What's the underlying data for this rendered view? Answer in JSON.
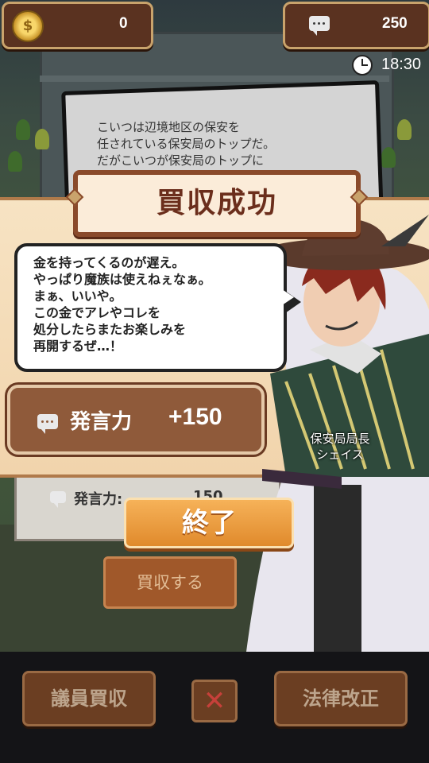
{
  "hud": {
    "coins": "0",
    "influence": "250",
    "time": "18:30"
  },
  "background_dialog": {
    "text": "こいつは辺境地区の保安を\n任されている保安局のトップだ。\nだがこいつが保安局のトップに"
  },
  "background_panel": {
    "label": "発言力:",
    "value": "150"
  },
  "popup": {
    "title": "買収成功",
    "speech": "金を持ってくるのが遅え。\nやっぱり魔族は使えねぇなぁ。\nまぁ、いいや。\nこの金でアレやコレを\n処分したらまたお楽しみを\n再開するぜ…！",
    "reward_label": "発言力",
    "reward_value": "+150",
    "character_name": "保安局局長\nシェイス"
  },
  "buttons": {
    "end": "終了",
    "bribe": "買収する"
  },
  "bottom_bar": {
    "bribe_member": "議員買収",
    "close": "✕",
    "law_reform": "法律改正"
  },
  "colors": {
    "accent_orange": "#e08a2c",
    "panel_brown": "#8f5a3a",
    "title_text": "#6b2e1c"
  }
}
